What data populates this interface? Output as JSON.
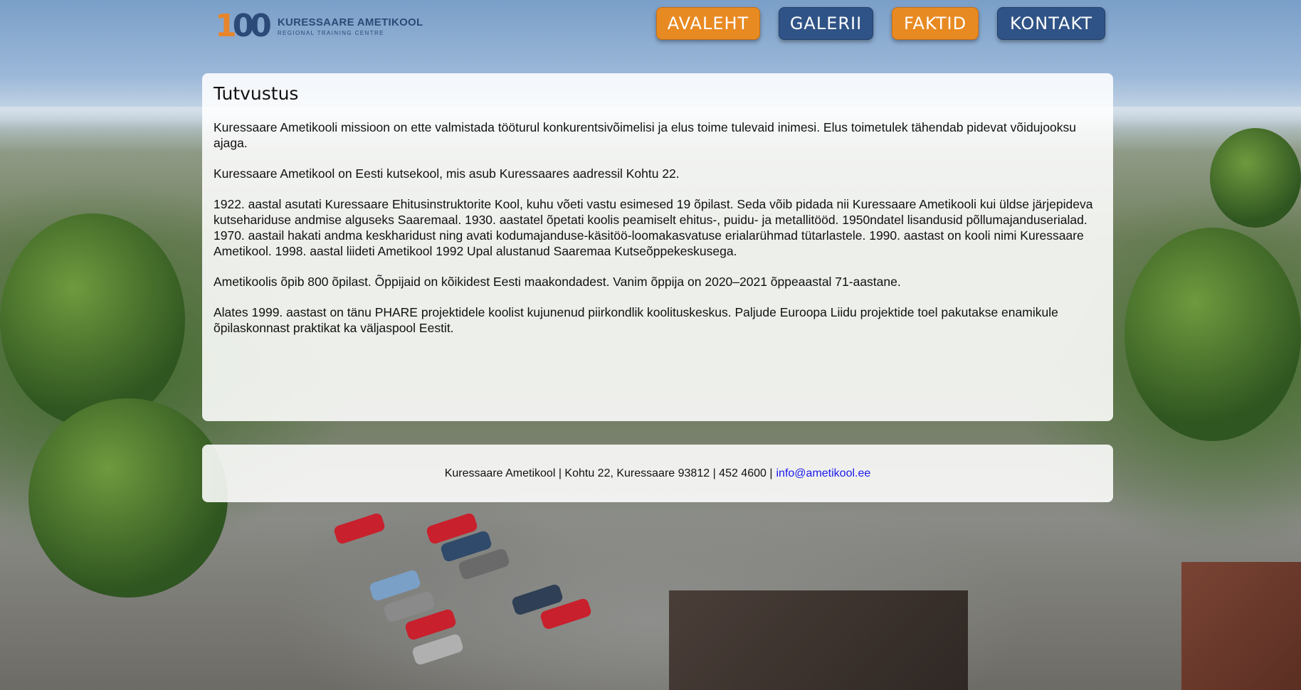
{
  "header": {
    "logo": {
      "mark_one": "1",
      "mark_zeros": "00",
      "title": "KURESSAARE AMETIKOOL",
      "subtitle": "REGIONAL TRAINING CENTRE"
    },
    "nav": [
      {
        "label": "AVALEHT",
        "color": "#e88a22"
      },
      {
        "label": "GALERII",
        "color": "#2f5386"
      },
      {
        "label": "FAKTID",
        "color": "#e88a22"
      },
      {
        "label": "KONTAKT",
        "color": "#2f5386"
      }
    ]
  },
  "content": {
    "heading": "Tutvustus",
    "paragraphs": [
      "Kuressaare Ametikooli missioon on ette valmistada tööturul konkurentsivõimelisi ja elus toime tulevaid inimesi. Elus toimetulek tähendab pidevat võidujooksu ajaga.",
      "Kuressaare Ametikool on Eesti kutsekool, mis asub Kuressaares aadressil Kohtu 22.",
      "1922. aastal asutati Kuressaare Ehitusinstruktorite Kool, kuhu võeti vastu esimesed 19 õpilast. Seda võib pidada nii Kuressaare Ametikooli kui üldse järjepideva kutsehariduse andmise alguseks Saaremaal. 1930. aastatel õpetati koolis peamiselt ehitus-, puidu- ja metallitööd. 1950ndatel lisandusid põllumajanduserialad. 1970. aastail hakati andma keskharidust ning avati kodumajanduse-käsitöö-loomakasvatuse erialarühmad tütarlastele. 1990. aastast on kooli nimi Kuressaare Ametikool. 1998. aastal liideti Ametikool 1992 Upal alustanud Saaremaa Kutseõppekeskusega.",
      "Ametikoolis õpib 800 õpilast. Õppijaid on kõikidest Eesti maakondadest. Vanim õppija on 2020–2021 õppeaastal 71-aastane.",
      "Alates 1999. aastast on tänu PHARE projektidele koolist kujunenud piirkondlik koolituskeskus. Paljude Euroopa Liidu projektide toel pakutakse enamikule õpilaskonnast praktikat ka väljaspool Eestit."
    ]
  },
  "footer": {
    "text": "Kuressaare Ametikool | Kohtu 22, Kuressaare 93812 | 452 4600 |",
    "email": "info@ametikool.ee"
  }
}
